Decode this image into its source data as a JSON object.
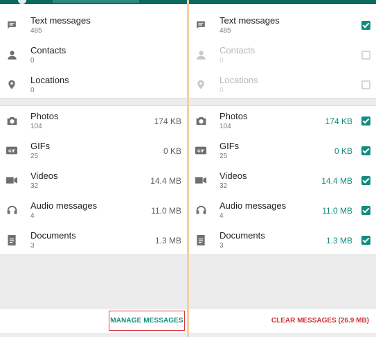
{
  "left": {
    "group1": [
      {
        "title": "Text messages",
        "count": "485",
        "icon": "message-icon"
      },
      {
        "title": "Contacts",
        "count": "0",
        "icon": "person-icon"
      },
      {
        "title": "Locations",
        "count": "0",
        "icon": "location-pin-icon"
      }
    ],
    "group2": [
      {
        "title": "Photos",
        "count": "104",
        "size": "174 KB",
        "icon": "camera-icon"
      },
      {
        "title": "GIFs",
        "count": "25",
        "size": "0 KB",
        "icon": "gif-icon"
      },
      {
        "title": "Videos",
        "count": "32",
        "size": "14.4 MB",
        "icon": "video-icon"
      },
      {
        "title": "Audio messages",
        "count": "4",
        "size": "11.0 MB",
        "icon": "headphones-icon"
      },
      {
        "title": "Documents",
        "count": "3",
        "size": "1.3 MB",
        "icon": "document-icon"
      }
    ],
    "button": "MANAGE MESSAGES"
  },
  "right": {
    "group1": [
      {
        "title": "Text messages",
        "count": "485",
        "checked": true,
        "enabled": true
      },
      {
        "title": "Contacts",
        "count": "0",
        "checked": false,
        "enabled": false
      },
      {
        "title": "Locations",
        "count": "0",
        "checked": false,
        "enabled": false
      }
    ],
    "group2": [
      {
        "title": "Photos",
        "count": "104",
        "size": "174 KB",
        "checked": true
      },
      {
        "title": "GIFs",
        "count": "25",
        "size": "0 KB",
        "checked": true
      },
      {
        "title": "Videos",
        "count": "32",
        "size": "14.4 MB",
        "checked": true
      },
      {
        "title": "Audio messages",
        "count": "4",
        "size": "11.0 MB",
        "checked": true
      },
      {
        "title": "Documents",
        "count": "3",
        "size": "1.3 MB",
        "checked": true
      }
    ],
    "button": "CLEAR MESSAGES (26.9 MB)"
  },
  "colors": {
    "accent": "#128c7e",
    "header": "#0a6b5c",
    "danger": "#d32f2f",
    "divider": "#f5cfa1"
  }
}
